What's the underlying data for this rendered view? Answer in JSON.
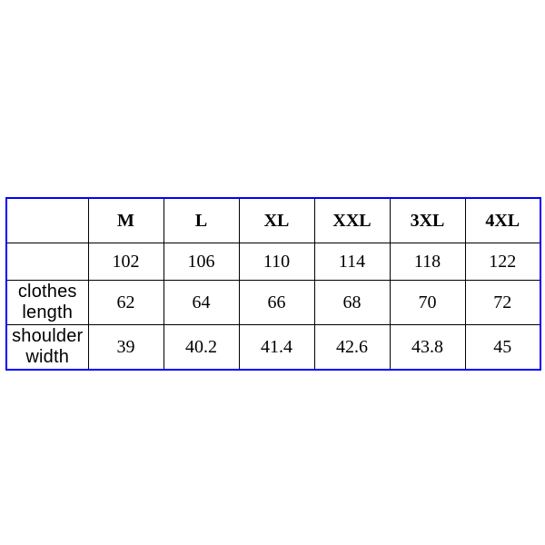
{
  "chart_data": {
    "type": "table",
    "columns": [
      "M",
      "L",
      "XL",
      "XXL",
      "3XL",
      "4XL"
    ],
    "rows": [
      {
        "label": "",
        "values": [
          102,
          106,
          110,
          114,
          118,
          122
        ]
      },
      {
        "label": "clothes length",
        "values": [
          62,
          64,
          66,
          68,
          70,
          72
        ]
      },
      {
        "label": "shoulder width",
        "values": [
          39,
          40.2,
          41.4,
          42.6,
          43.8,
          45
        ]
      }
    ]
  }
}
